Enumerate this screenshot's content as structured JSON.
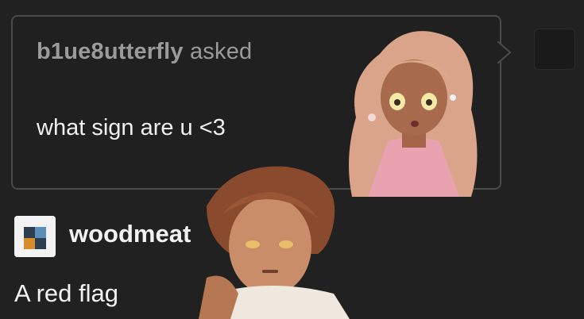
{
  "ask": {
    "asker": "b1ue8utterfly",
    "asked_label": "asked",
    "question": "what sign are u <3"
  },
  "answer": {
    "username": "woodmeat",
    "text": "A red flag"
  },
  "colors": {
    "background": "#212121",
    "card_border": "#4a4a4a",
    "muted_text": "#9b9b9b",
    "text": "#f0f0f0"
  }
}
